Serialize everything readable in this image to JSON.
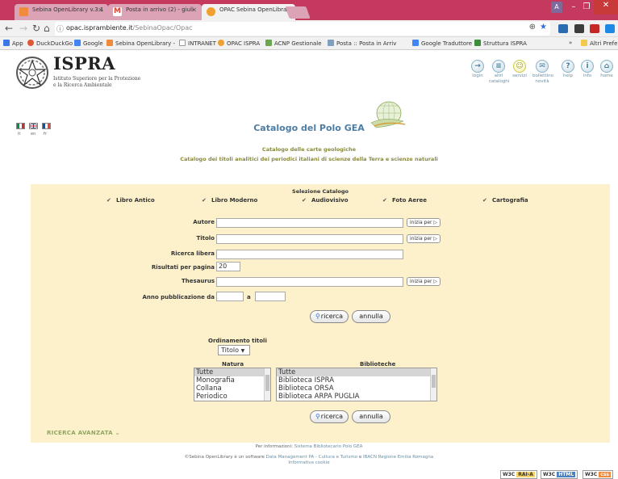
{
  "browser": {
    "tabs": [
      {
        "label": "Sebina OpenLibrary v.3.1",
        "color": "#f08a3c"
      },
      {
        "label": "Posta in arrivo (2) - giuli",
        "color": "#d44638"
      },
      {
        "label": "OPAC Sebina OpenLibrary",
        "color": "#f0a030"
      }
    ],
    "url_host": "opac.isprambiente.it",
    "url_path": "/SebinaOpac/Opac",
    "user_badge": "A",
    "bookmarks": [
      {
        "label": "App",
        "color": "#3b78e7"
      },
      {
        "label": "DuckDuckGo",
        "color": "#de5833"
      },
      {
        "label": "Google",
        "color": "#4285f4"
      },
      {
        "label": "Sebina OpenLibrary -",
        "color": "#f08a3c"
      },
      {
        "label": "INTRANET",
        "color": "#bbbbbb"
      },
      {
        "label": "OPAC ISPRA",
        "color": "#f0a030"
      },
      {
        "label": "ACNP Gestionale",
        "color": "#6aa84f"
      },
      {
        "label": "Posta :: Posta in Arriv",
        "color": "#7f9fbf"
      },
      {
        "label": "Google Traduttore",
        "color": "#4285f4"
      },
      {
        "label": "Struttura ISPRA",
        "color": "#3c8d3c"
      },
      {
        "label": "Altri Prefer",
        "color": "#f2c94c"
      }
    ],
    "bookmarks_more": "»"
  },
  "header": {
    "brand": "ISPRA",
    "brand_sub_1": "Istituto Superiore per la Protezione",
    "brand_sub_2": "e la Ricerca Ambientale",
    "nav": [
      {
        "label": "login",
        "glyph": "→",
        "icon": "login-icon"
      },
      {
        "label": "altri cataloghi",
        "glyph": "≡",
        "icon": "catalogs-icon"
      },
      {
        "label": "servizi",
        "glyph": "☺",
        "icon": "services-icon"
      },
      {
        "label": "bollettino novità",
        "glyph": "✉",
        "icon": "newsletter-icon"
      },
      {
        "label": "help",
        "glyph": "?",
        "icon": "help-icon"
      },
      {
        "label": "info",
        "glyph": "i",
        "icon": "info-icon"
      },
      {
        "label": "home",
        "glyph": "⌂",
        "icon": "home-icon"
      }
    ],
    "languages": [
      {
        "label": "it",
        "colors": [
          "#009246",
          "#ffffff",
          "#ce2b37"
        ]
      },
      {
        "label": "en",
        "colors": [
          "#012169",
          "#ffffff",
          "#c8102e"
        ]
      },
      {
        "label": "fr",
        "colors": [
          "#0055a4",
          "#ffffff",
          "#ef4135"
        ]
      }
    ]
  },
  "catalog": {
    "title": "Catalogo del Polo GEA",
    "subtitle_1": "Catalogo delle carte geologiche",
    "subtitle_2": "Catalogo dei titoli analitici dei periodici italiani di scienze della Terra e scienze naturali"
  },
  "search": {
    "selection_title": "Selezione Catalogo",
    "catalogs": [
      "Libro Antico",
      "Libro Moderno",
      "Audiovisivo",
      "Foto Aeree",
      "Cartografia"
    ],
    "fields": {
      "autore": "Autore",
      "titolo": "Titolo",
      "ricerca_libera": "Ricerca libera",
      "risultati": "Risultati per pagina",
      "risultati_value": "20",
      "thesaurus": "Thesaurus",
      "anno_da": "Anno pubblicazione da",
      "anno_a": "a"
    },
    "inizia_per": "inizia per",
    "ricerca_btn": "ricerca",
    "annulla_btn": "annulla",
    "ordinamento_title": "Ordinamento titoli",
    "ordinamento_value": "Titolo",
    "natura_title": "Natura",
    "natura_options": [
      "Tutte",
      "Monografia",
      "Collana",
      "Periodico"
    ],
    "biblioteche_title": "Biblioteche",
    "biblioteche_options": [
      "Tutte",
      "Biblioteca ISPRA",
      "Biblioteca ORSA",
      "Biblioteca ARPA PUGLIA"
    ],
    "advanced": "RICERCA AVANZATA"
  },
  "footer": {
    "info_prefix": "Per informazioni:",
    "info_link": "Sistema Bibliotecario Polo GEA",
    "software_prefix": "©Sebina OpenLibrary è un software",
    "software_link_1": "Data Management PA - Cultura e Turismo",
    "software_and": "e",
    "software_link_2": "IBACN Regione Emilia Romagna",
    "cookie": "Informativa cookie",
    "badges": [
      {
        "label": "W3C RAI-A",
        "color": "#f3d36b"
      },
      {
        "label": "W3C HTML",
        "color": "#4a7fc1"
      },
      {
        "label": "W3C css",
        "color": "#f08a3c"
      }
    ]
  }
}
